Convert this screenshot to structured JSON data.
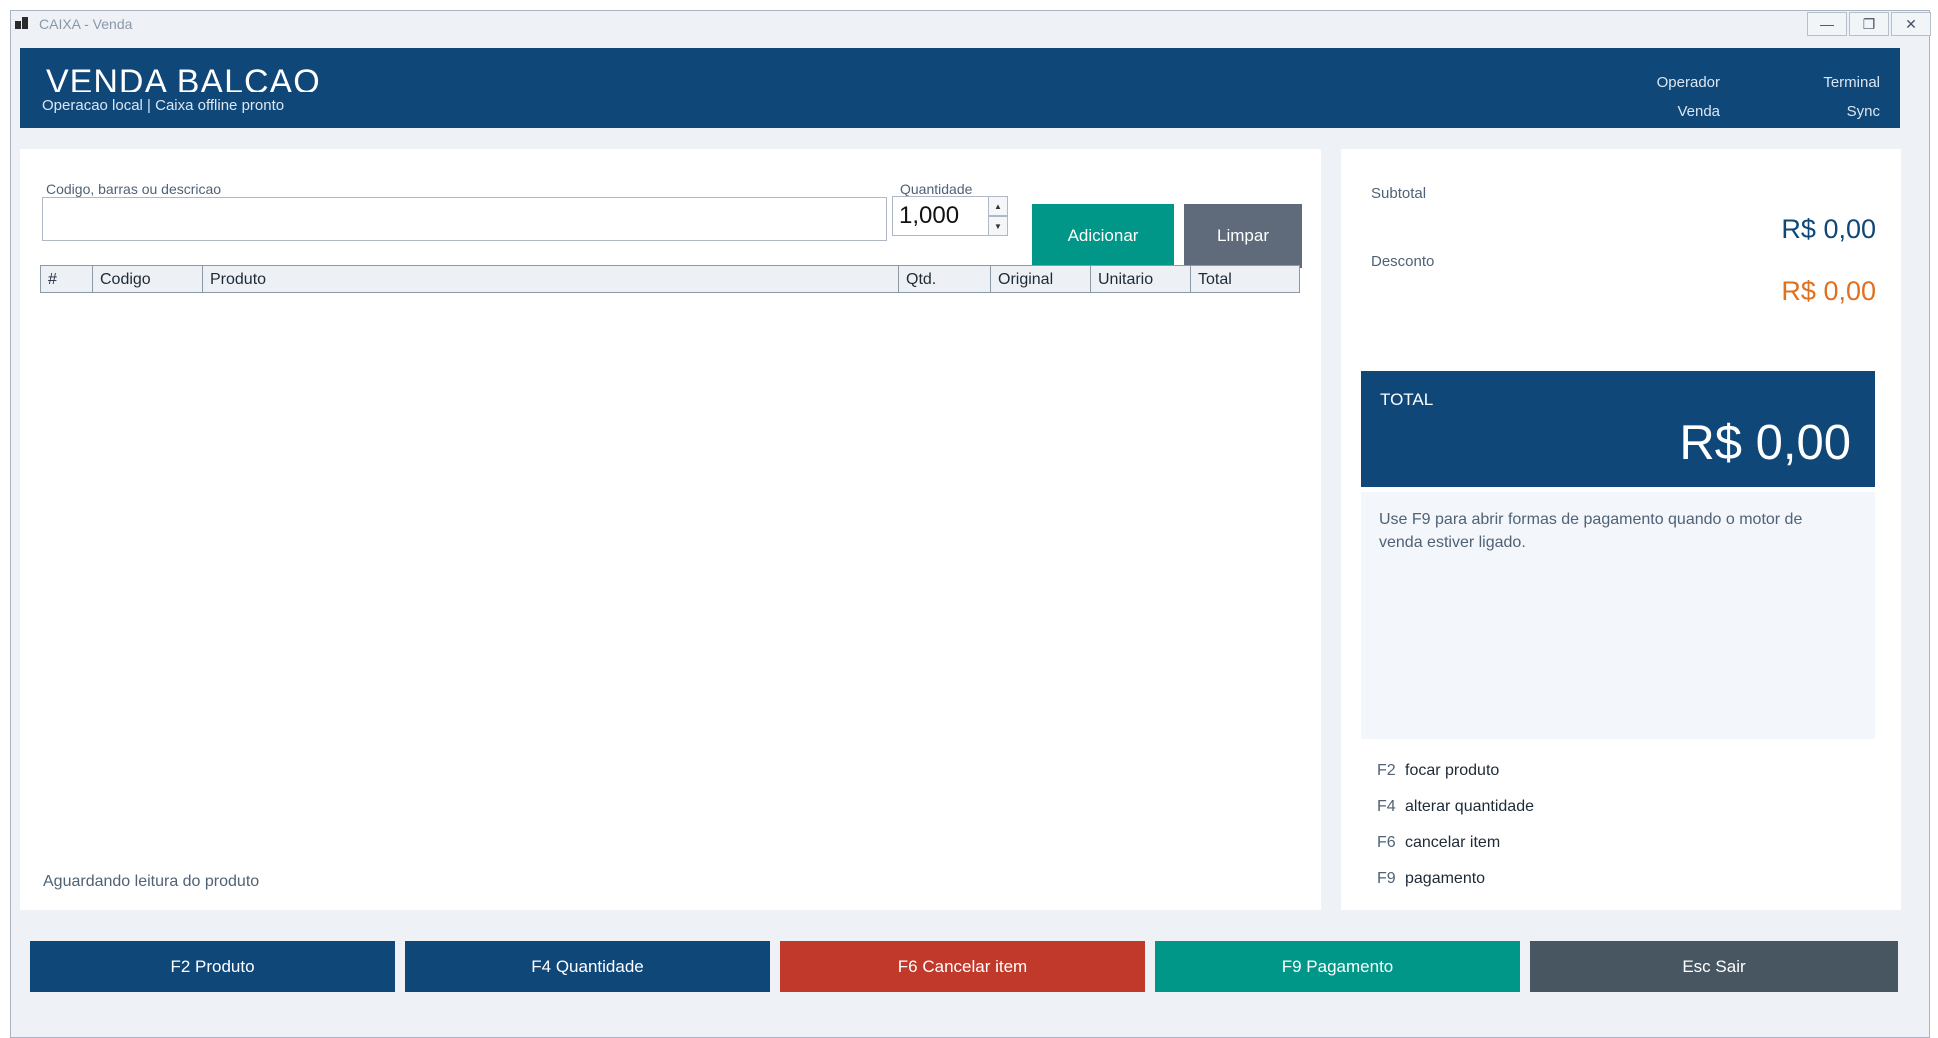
{
  "window": {
    "title": "CAIXA - Venda",
    "controls": {
      "minimize": "—",
      "restore": "❐",
      "close": "✕"
    }
  },
  "header": {
    "title": "VENDA BALCAO",
    "subtitle": "Operacao local | Caixa offline pronto",
    "operator_label": "Operador",
    "terminal_label": "Terminal",
    "sale_label": "Venda",
    "sync_label": "Sync"
  },
  "entry": {
    "search_label": "Codigo, barras ou descricao",
    "search_value": "",
    "quantity_label": "Quantidade",
    "quantity_value": "1,000",
    "add_label": "Adicionar",
    "clear_label": "Limpar"
  },
  "table": {
    "columns": [
      "#",
      "Codigo",
      "Produto",
      "Qtd.",
      "Original",
      "Unitario",
      "Total"
    ],
    "rows": []
  },
  "status_text": "Aguardando leitura do produto",
  "summary": {
    "subtotal_label": "Subtotal",
    "subtotal_value": "R$ 0,00",
    "discount_label": "Desconto",
    "discount_value": "R$ 0,00",
    "total_label": "TOTAL",
    "total_value": "R$ 0,00",
    "note": "Use F9 para abrir formas de pagamento quando o motor de venda estiver ligado."
  },
  "shortcuts": [
    {
      "key": "F2",
      "label": "focar produto"
    },
    {
      "key": "F4",
      "label": "alterar quantidade"
    },
    {
      "key": "F6",
      "label": "cancelar item"
    },
    {
      "key": "F9",
      "label": "pagamento"
    }
  ],
  "bottom_buttons": {
    "product": "F2 Produto",
    "quantity": "F4 Quantidade",
    "cancel": "F6 Cancelar item",
    "payment": "F9 Pagamento",
    "exit": "Esc Sair"
  },
  "colors": {
    "brand": "#0f4779",
    "add": "#009688",
    "clear": "#5f6b7a",
    "cancel": "#c0392b",
    "exit": "#475661",
    "discount": "#e07020"
  }
}
